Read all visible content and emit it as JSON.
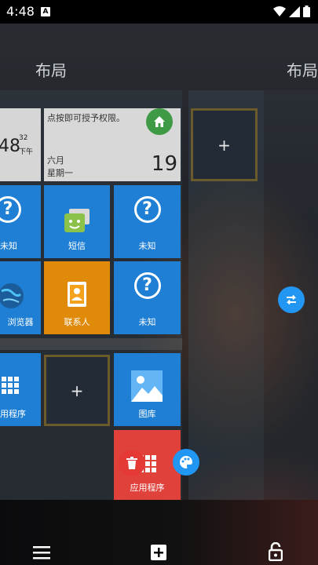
{
  "status_bar": {
    "time": "4:48",
    "notification_icon": "A"
  },
  "pages": {
    "left_title": "布局",
    "right_title": "布局"
  },
  "clock_tile": {
    "time": "48",
    "seconds": "32",
    "ampm": "下午"
  },
  "calendar_tile": {
    "notice": "点按即可授予权限。",
    "month": "六月",
    "weekday": "星期一",
    "day": "19"
  },
  "tiles": {
    "unknown_1": "未知",
    "sms": "短信",
    "unknown_2": "未知",
    "browser": "浏览器",
    "contacts": "联系人",
    "unknown_3": "未知",
    "apps_1": "用程序",
    "gallery": "图库",
    "apps_2": "应用程序"
  },
  "add_slot_symbol": "+",
  "colors": {
    "tile_blue": "#1e7fd4",
    "tile_orange": "#e08a0a",
    "tile_red": "#e0413b",
    "home_green": "#3e9a45",
    "fab_blue": "#2196f3"
  },
  "icons": [
    "home-icon",
    "help-icon",
    "sms-icon",
    "browser-icon",
    "contacts-icon",
    "grid-icon",
    "gallery-icon",
    "delete-icon",
    "palette-icon",
    "swap-icon",
    "menu-icon",
    "add-box-icon",
    "unlock-icon",
    "wifi-icon",
    "signal-icon",
    "battery-icon"
  ]
}
